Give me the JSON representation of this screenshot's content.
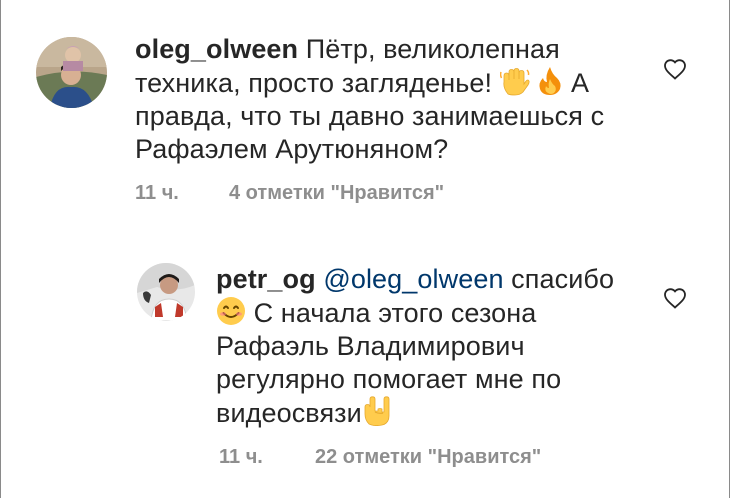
{
  "comments": [
    {
      "username": "oleg_olween",
      "text_part1": "Пётр, великолепная техника, просто загляденье!",
      "emoji_1": "waving-hand-emoji",
      "emoji_2": "fire-emoji",
      "text_part2": "А правда, что ты давно занимаешься с Рафаэлем Арутюняном?",
      "time": "11 ч.",
      "likes": "4 отметки \"Нравится\""
    },
    {
      "username": "petr_og",
      "mention": "@oleg_olween",
      "text_part1": "спасибо",
      "emoji_1": "smiling-face-emoji",
      "text_part2": "С начала этого сезона Рафаэль Владимирович регулярно помогает мне по видеосвязи",
      "emoji_2": "sign-of-the-horns-emoji",
      "time": "11 ч.",
      "likes": "22 отметки \"Нравится\""
    }
  ],
  "colors": {
    "text": "#262626",
    "secondary": "#8e8e8e",
    "mention": "#00376b",
    "background": "#ffffff"
  }
}
